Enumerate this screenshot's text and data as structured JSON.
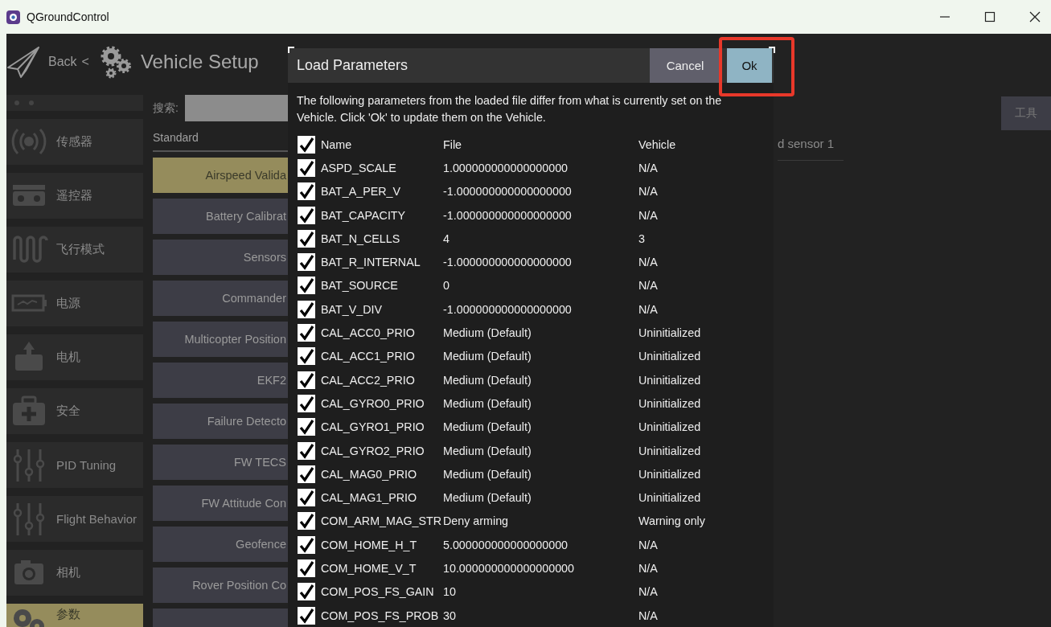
{
  "window": {
    "title": "QGroundControl"
  },
  "header": {
    "back": "Back",
    "separator": "<",
    "title": "Vehicle Setup"
  },
  "sidebar": {
    "items": [
      {
        "label": "传感器",
        "selected": false
      },
      {
        "label": "遥控器",
        "selected": false
      },
      {
        "label": "飞行模式",
        "selected": false
      },
      {
        "label": "电源",
        "selected": false
      },
      {
        "label": "电机",
        "selected": false
      },
      {
        "label": "安全",
        "selected": false
      },
      {
        "label": "PID Tuning",
        "selected": false
      },
      {
        "label": "Flight Behavior",
        "selected": false
      },
      {
        "label": "相机",
        "selected": false
      },
      {
        "label": "参数",
        "selected": true
      }
    ]
  },
  "parameters": {
    "search_label": "搜索:",
    "category": "Standard",
    "groups": [
      {
        "label": "Airspeed Valida",
        "selected": true
      },
      {
        "label": "Battery Calibrat",
        "selected": false
      },
      {
        "label": "Sensors",
        "selected": false
      },
      {
        "label": "Commander",
        "selected": false
      },
      {
        "label": "Multicopter Position",
        "selected": false
      },
      {
        "label": "EKF2",
        "selected": false
      },
      {
        "label": "Failure Detecto",
        "selected": false
      },
      {
        "label": "FW TECS",
        "selected": false
      },
      {
        "label": "FW Attitude Con",
        "selected": false
      },
      {
        "label": "Geofence",
        "selected": false
      },
      {
        "label": "Rover Position Co",
        "selected": false
      },
      {
        "selected": false
      }
    ],
    "detail_text": "d sensor 1",
    "tools_button": "工具"
  },
  "dialog": {
    "title": "Load Parameters",
    "buttons": [
      {
        "label": "Cancel",
        "kind": "secondary",
        "highlighted": false
      },
      {
        "label": "Ok",
        "kind": "primary",
        "highlighted": true
      }
    ],
    "message": "The following parameters from the loaded file differ from what is currently set on the Vehicle. Click 'Ok' to update them on the Vehicle.",
    "columns": {
      "checked": true,
      "name": "Name",
      "file": "File",
      "vehicle": "Vehicle"
    },
    "rows": [
      {
        "checked": true,
        "name": "ASPD_SCALE",
        "file": "1.000000000000000000",
        "vehicle": "N/A"
      },
      {
        "checked": true,
        "name": "BAT_A_PER_V",
        "file": "-1.000000000000000000",
        "vehicle": "N/A"
      },
      {
        "checked": true,
        "name": "BAT_CAPACITY",
        "file": "-1.000000000000000000",
        "vehicle": "N/A"
      },
      {
        "checked": true,
        "name": "BAT_N_CELLS",
        "file": "4",
        "vehicle": "3"
      },
      {
        "checked": true,
        "name": "BAT_R_INTERNAL",
        "file": "-1.000000000000000000",
        "vehicle": "N/A"
      },
      {
        "checked": true,
        "name": "BAT_SOURCE",
        "file": "0",
        "vehicle": "N/A"
      },
      {
        "checked": true,
        "name": "BAT_V_DIV",
        "file": "-1.000000000000000000",
        "vehicle": "N/A"
      },
      {
        "checked": true,
        "name": "CAL_ACC0_PRIO",
        "file": "Medium (Default)",
        "vehicle": "Uninitialized"
      },
      {
        "checked": true,
        "name": "CAL_ACC1_PRIO",
        "file": "Medium (Default)",
        "vehicle": "Uninitialized"
      },
      {
        "checked": true,
        "name": "CAL_ACC2_PRIO",
        "file": "Medium (Default)",
        "vehicle": "Uninitialized"
      },
      {
        "checked": true,
        "name": "CAL_GYRO0_PRIO",
        "file": "Medium (Default)",
        "vehicle": "Uninitialized"
      },
      {
        "checked": true,
        "name": "CAL_GYRO1_PRIO",
        "file": "Medium (Default)",
        "vehicle": "Uninitialized"
      },
      {
        "checked": true,
        "name": "CAL_GYRO2_PRIO",
        "file": "Medium (Default)",
        "vehicle": "Uninitialized"
      },
      {
        "checked": true,
        "name": "CAL_MAG0_PRIO",
        "file": "Medium (Default)",
        "vehicle": "Uninitialized"
      },
      {
        "checked": true,
        "name": "CAL_MAG1_PRIO",
        "file": "Medium (Default)",
        "vehicle": "Uninitialized"
      },
      {
        "checked": true,
        "name": "COM_ARM_MAG_STR",
        "file": "Deny arming",
        "vehicle": "Warning only"
      },
      {
        "checked": true,
        "name": "COM_HOME_H_T",
        "file": "5.000000000000000000",
        "vehicle": "N/A"
      },
      {
        "checked": true,
        "name": "COM_HOME_V_T",
        "file": "10.000000000000000000",
        "vehicle": "N/A"
      },
      {
        "checked": true,
        "name": "COM_POS_FS_GAIN",
        "file": "10",
        "vehicle": "N/A"
      },
      {
        "checked": true,
        "name": "COM_POS_FS_PROB",
        "file": "30",
        "vehicle": "N/A"
      }
    ]
  }
}
